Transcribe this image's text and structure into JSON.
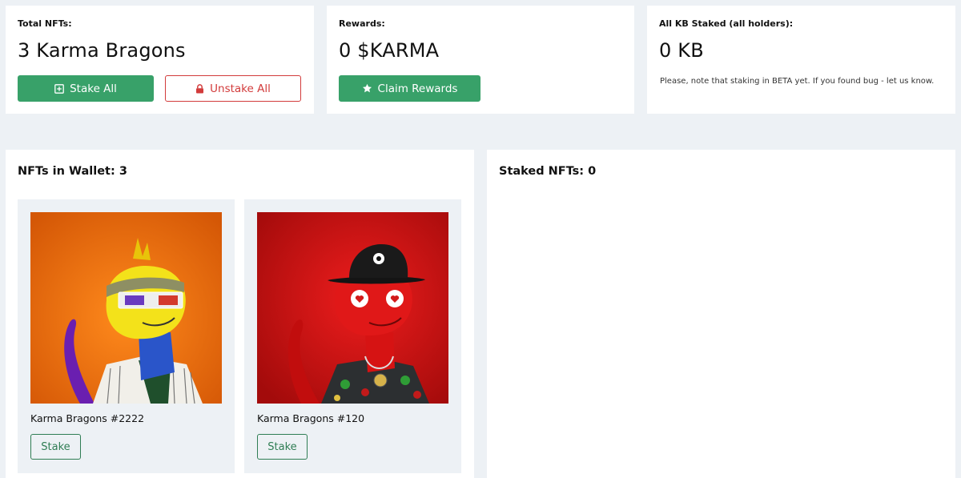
{
  "summary": {
    "total_nfts": {
      "label": "Total NFTs:",
      "value": "3 Karma Bragons"
    },
    "stake_all_label": "Stake All",
    "unstake_all_label": "Unstake All",
    "rewards": {
      "label": "Rewards:",
      "value": "0 $KARMA"
    },
    "claim_label": "Claim Rewards",
    "all_staked": {
      "label": "All KB Staked (all holders):",
      "value": "0 KB",
      "note": "Please, note that staking in BETA yet. If you found bug - let us know."
    }
  },
  "wallet": {
    "title": "NFTs in Wallet: 3",
    "items": [
      {
        "name": "Karma Bragons #2222",
        "stake_label": "Stake",
        "image": "yellow-dragon-with-3d-glasses"
      },
      {
        "name": "Karma Bragons #120",
        "stake_label": "Stake",
        "image": "red-dragon-with-black-hat"
      }
    ]
  },
  "staked": {
    "title": "Staked NFTs: 0"
  },
  "colors": {
    "accent_green": "#38a169",
    "danger_red": "#d23b3b",
    "page_bg": "#edf1f5"
  }
}
